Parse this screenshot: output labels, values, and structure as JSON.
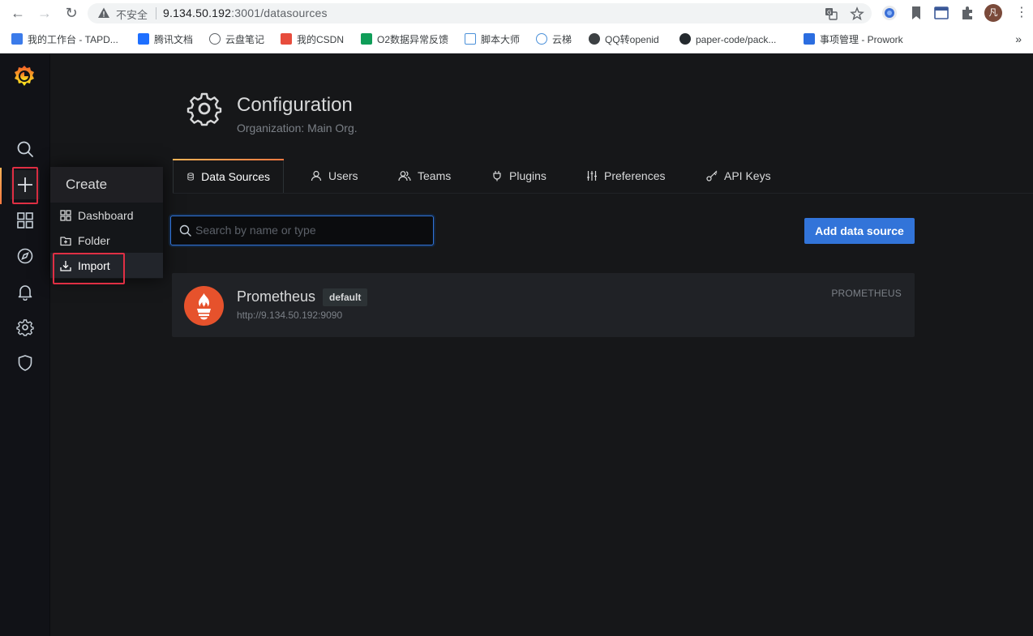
{
  "browser": {
    "insecure_label": "不安全",
    "url_host": "9.134.50.192",
    "url_path": ":3001/datasources",
    "avatar_text": "凡"
  },
  "bookmarks": [
    {
      "label": "我的工作台 - TAPD...",
      "color": "#3b7bea"
    },
    {
      "label": "腾讯文档",
      "color": "#1e6fff"
    },
    {
      "label": "云盘笔记",
      "color": "#5f6368"
    },
    {
      "label": "我的CSDN",
      "color": "#e74c3c"
    },
    {
      "label": "O2数据异常反馈",
      "color": "#0f9d58"
    },
    {
      "label": "脚本大师",
      "color": "#4a90d9"
    },
    {
      "label": "云梯",
      "color": "#4a90d9"
    },
    {
      "label": "QQ转openid",
      "color": "#3c4043"
    },
    {
      "label": "paper-code/pack...",
      "color": "#24292e"
    },
    {
      "label": "事项管理 - Prowork",
      "color": "#2b6de0"
    }
  ],
  "bookmarks_more": "»",
  "create_menu": {
    "header": "Create",
    "items": [
      {
        "label": "Dashboard",
        "icon": "apps-icon"
      },
      {
        "label": "Folder",
        "icon": "folder-plus-icon"
      },
      {
        "label": "Import",
        "icon": "import-icon"
      }
    ]
  },
  "page": {
    "title": "Configuration",
    "subtitle": "Organization: Main Org."
  },
  "tabs": [
    {
      "label": "Data Sources",
      "icon": "database-icon",
      "active": true
    },
    {
      "label": "Users",
      "icon": "user-icon"
    },
    {
      "label": "Teams",
      "icon": "users-icon"
    },
    {
      "label": "Plugins",
      "icon": "plug-icon"
    },
    {
      "label": "Preferences",
      "icon": "sliders-icon"
    },
    {
      "label": "API Keys",
      "icon": "key-icon"
    }
  ],
  "search": {
    "placeholder": "Search by name or type"
  },
  "add_button": "Add data source",
  "datasources": [
    {
      "name": "Prometheus",
      "badge": "default",
      "url": "http://9.134.50.192:9090",
      "type": "PROMETHEUS"
    }
  ],
  "colors": {
    "accent": "#3274d9",
    "highlight": "#e02f44",
    "brand_orange": "#ff7941",
    "prometheus": "#e6522c"
  }
}
